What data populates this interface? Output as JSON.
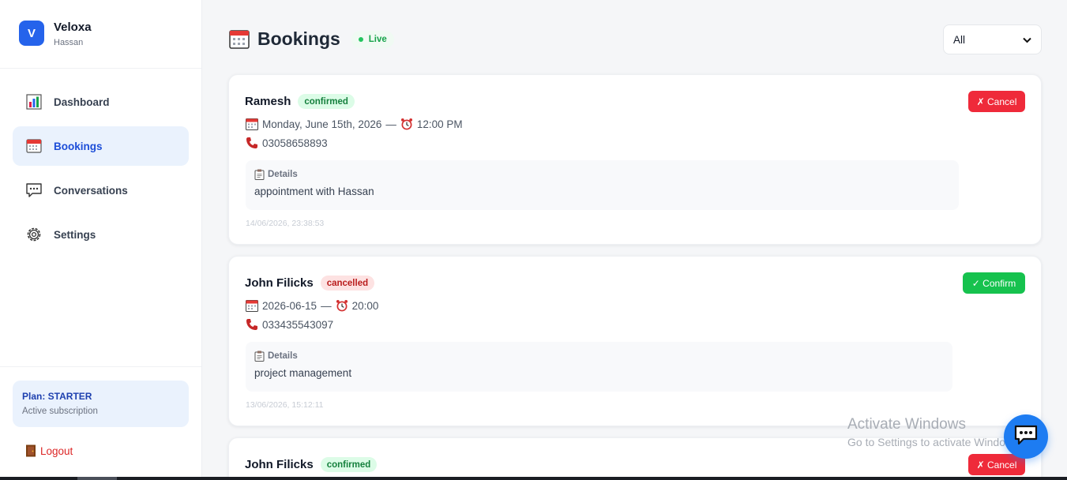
{
  "brand": {
    "logo_letter": "V",
    "name": "Veloxa",
    "user": "Hassan",
    "accent": "#2563eb"
  },
  "sidebar": {
    "items": [
      {
        "label": "Dashboard",
        "icon": "bar-chart-icon",
        "active": false
      },
      {
        "label": "Bookings",
        "icon": "calendar-icon",
        "active": true
      },
      {
        "label": "Conversations",
        "icon": "chat-bubble-icon",
        "active": false
      },
      {
        "label": "Settings",
        "icon": "gear-icon",
        "active": false
      }
    ],
    "plan": {
      "title": "Plan: STARTER",
      "subtitle": "Active subscription"
    },
    "logout": "Logout"
  },
  "header": {
    "title": "Bookings",
    "icon": "calendar-icon",
    "live_label": "Live",
    "filter": {
      "selected": "All",
      "options": [
        "All"
      ]
    }
  },
  "bookings": [
    {
      "name": "Ramesh",
      "status": "confirmed",
      "date": "Monday, June 15th, 2026",
      "separator": "—",
      "time": "12:00 PM",
      "phone": "03058658893",
      "details_label": "Details",
      "details": "appointment with Hassan",
      "created": "14/06/2026, 23:38:53",
      "action": "✗ Cancel"
    },
    {
      "name": "John Filicks",
      "status": "cancelled",
      "date": "2026-06-15",
      "separator": "—",
      "time": "20:00",
      "phone": "033435543097",
      "details_label": "Details",
      "details": "project management",
      "created": "13/06/2026, 15:12:11",
      "action": "✓ Confirm"
    },
    {
      "name": "John Filicks",
      "status": "confirmed",
      "action": "✗ Cancel"
    }
  ],
  "watermark": {
    "title": "Activate Windows",
    "subtitle": "Go to Settings to activate Windows."
  },
  "colors": {
    "cancel": "#ef2a3a",
    "confirm": "#16c24e",
    "live": "#16a34a",
    "chat": "#1d7cf2"
  }
}
